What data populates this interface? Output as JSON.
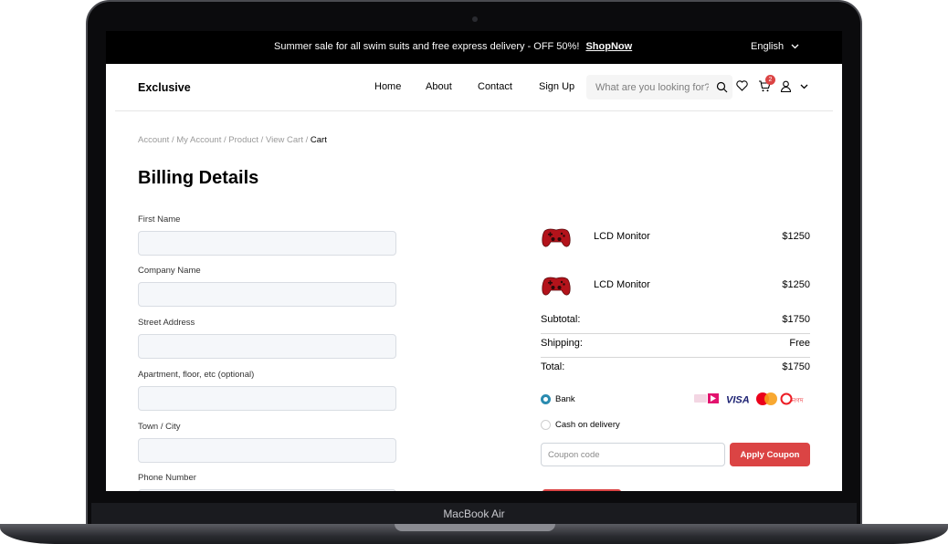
{
  "topbar": {
    "promo": "Summer sale for all swim suits and free express delivery - OFF 50%!",
    "shop_now": "ShopNow",
    "language": "English"
  },
  "header": {
    "logo": "Exclusive",
    "nav": [
      "Home",
      "About",
      "Contact",
      "Sign Up"
    ],
    "search_placeholder": "What are you looking for?",
    "cart_count": "2"
  },
  "breadcrumb": {
    "items": [
      "Account",
      "My Account",
      "Product",
      "View Cart"
    ],
    "current": "Cart"
  },
  "billing": {
    "title": "Billing Details",
    "fields": [
      {
        "label": "First Name",
        "value": ""
      },
      {
        "label": "Company Name",
        "value": ""
      },
      {
        "label": "Street Address",
        "value": ""
      },
      {
        "label": "Apartment, floor, etc (optional)",
        "value": ""
      },
      {
        "label": "Town / City",
        "value": ""
      },
      {
        "label": "Phone Number",
        "value": ""
      }
    ]
  },
  "order": {
    "items": [
      {
        "name": "LCD Monitor",
        "price": "$1250"
      },
      {
        "name": "LCD Monitor",
        "price": "$1250"
      }
    ],
    "subtotal_label": "Subtotal:",
    "subtotal": "$1750",
    "shipping_label": "Shipping:",
    "shipping": "Free",
    "total_label": "Total:",
    "total": "$1750",
    "payment": {
      "bank_label": "Bank",
      "cod_label": "Cash on delivery",
      "selected": "Bank"
    },
    "coupon_placeholder": "Coupon code",
    "apply_label": "Apply Coupon"
  },
  "device": {
    "label": "MacBook Air"
  },
  "colors": {
    "accent": "#DB4444",
    "radio": "#2A8BB0"
  }
}
